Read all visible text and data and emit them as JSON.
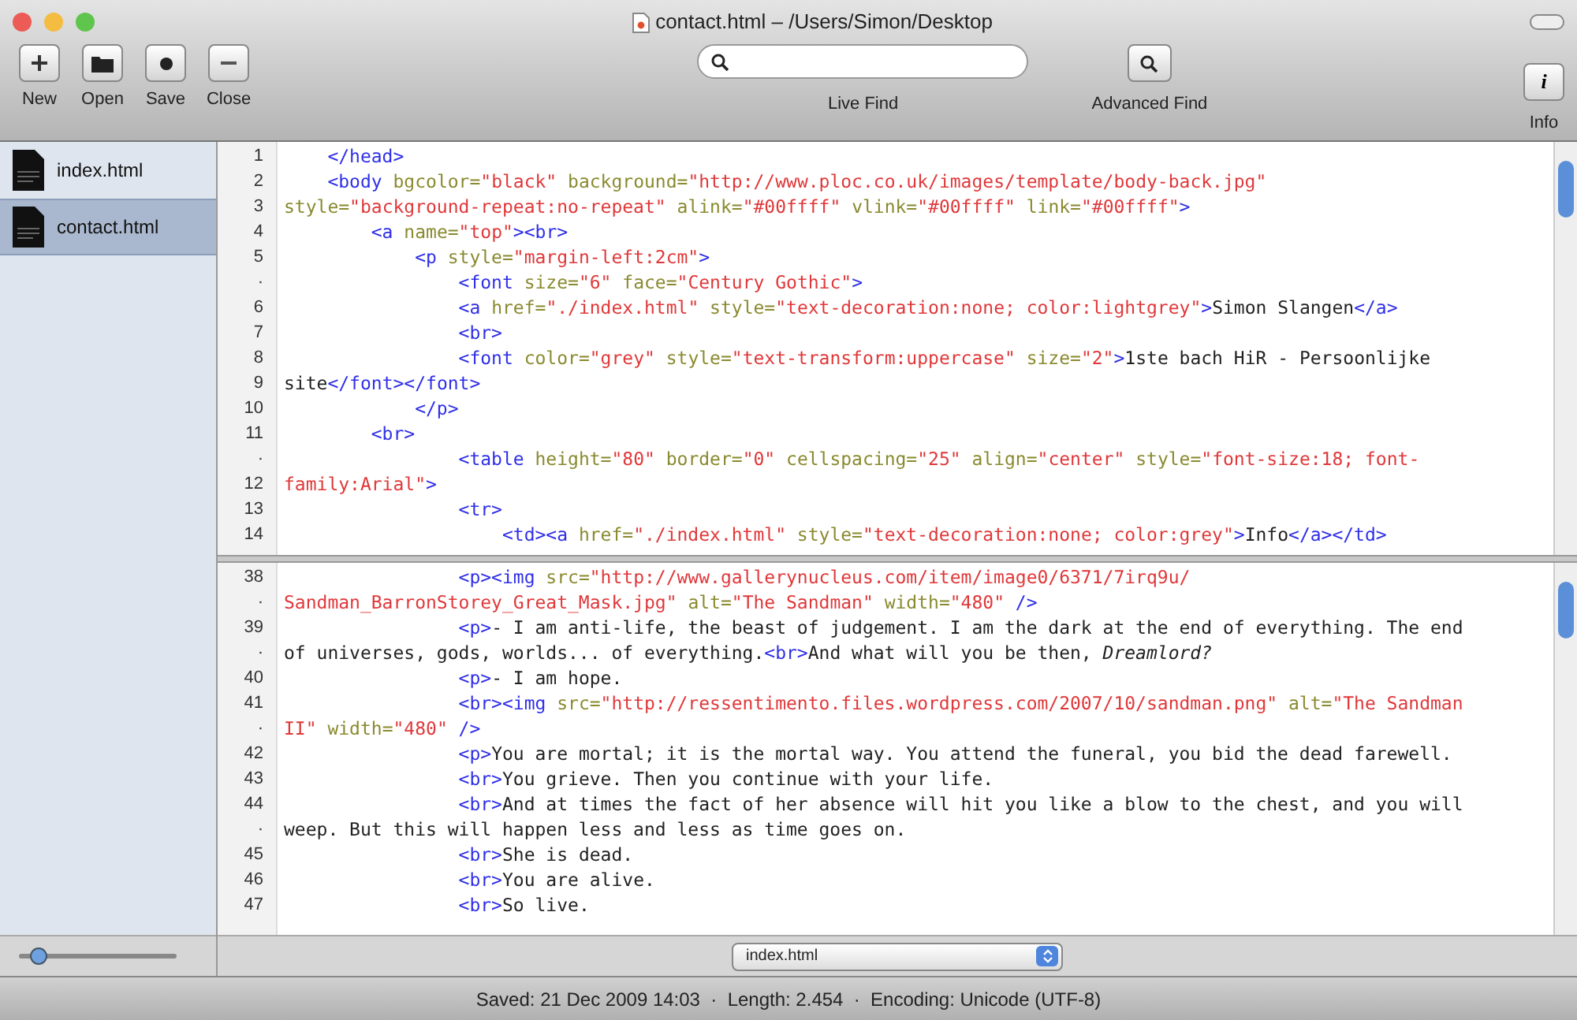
{
  "window": {
    "title": "contact.html – /Users/Simon/Desktop"
  },
  "toolbar": {
    "buttons": [
      {
        "kind": "plus",
        "label": "New"
      },
      {
        "kind": "folder",
        "label": "Open"
      },
      {
        "kind": "dot",
        "label": "Save"
      },
      {
        "kind": "minus",
        "label": "Close"
      }
    ],
    "live_find": {
      "label": "Live Find"
    },
    "advanced_find": {
      "label": "Advanced Find"
    },
    "info": {
      "glyph": "i",
      "label": "Info"
    }
  },
  "sidebar": {
    "files": [
      {
        "name": "index.html",
        "selected": false
      },
      {
        "name": "contact.html",
        "selected": true
      }
    ],
    "zoom_slider": {
      "level": 0.12
    }
  },
  "editor": {
    "panes": [
      {
        "rows": [
          {
            "number": "1",
            "tokens": [
              {
                "kind": "tag",
                "text": "    </head>"
              }
            ]
          },
          {
            "number": "2",
            "tokens": [
              {
                "kind": "tag",
                "text": "    <body "
              },
              {
                "kind": "attr",
                "text": "bgcolor="
              },
              {
                "kind": "value",
                "text": "\"black\" "
              },
              {
                "kind": "attr",
                "text": "background="
              },
              {
                "kind": "value",
                "text": "\"http://www.ploc.co.uk/images/template/body-back.jpg\""
              }
            ]
          },
          {
            "number": "3",
            "tokens": [
              {
                "kind": "attr",
                "text": "style="
              },
              {
                "kind": "value",
                "text": "\"background-repeat:no-repeat\" "
              },
              {
                "kind": "attr",
                "text": "alink="
              },
              {
                "kind": "value",
                "text": "\"#00ffff\" "
              },
              {
                "kind": "attr",
                "text": "vlink="
              },
              {
                "kind": "value",
                "text": "\"#00ffff\" "
              },
              {
                "kind": "attr",
                "text": "link="
              },
              {
                "kind": "value",
                "text": "\"#00ffff\""
              },
              {
                "kind": "tag",
                "text": ">"
              }
            ]
          },
          {
            "number": "4",
            "tokens": [
              {
                "kind": "tag",
                "text": "        <a "
              },
              {
                "kind": "attr",
                "text": "name="
              },
              {
                "kind": "value",
                "text": "\"top\""
              },
              {
                "kind": "tag",
                "text": "><br>"
              }
            ]
          },
          {
            "number": "5",
            "tokens": [
              {
                "kind": "tag",
                "text": "            <p "
              },
              {
                "kind": "attr",
                "text": "style="
              },
              {
                "kind": "value",
                "text": "\"margin-left:2cm\""
              },
              {
                "kind": "tag",
                "text": ">"
              }
            ]
          },
          {
            "number": "·",
            "tokens": [
              {
                "kind": "tag",
                "text": "                <font "
              },
              {
                "kind": "attr",
                "text": "size="
              },
              {
                "kind": "value",
                "text": "\"6\" "
              },
              {
                "kind": "attr",
                "text": "face="
              },
              {
                "kind": "value",
                "text": "\"Century Gothic\""
              },
              {
                "kind": "tag",
                "text": ">"
              }
            ]
          },
          {
            "number": "6",
            "tokens": [
              {
                "kind": "tag",
                "text": "                <a "
              },
              {
                "kind": "attr",
                "text": "href="
              },
              {
                "kind": "value",
                "text": "\"./index.html\" "
              },
              {
                "kind": "attr",
                "text": "style="
              },
              {
                "kind": "value",
                "text": "\"text-decoration:none; color:lightgrey\""
              },
              {
                "kind": "tag",
                "text": ">"
              },
              {
                "kind": "text",
                "text": "Simon Slangen"
              },
              {
                "kind": "tag",
                "text": "</a>"
              }
            ]
          },
          {
            "number": "7",
            "tokens": [
              {
                "kind": "tag",
                "text": "                <br>"
              }
            ]
          },
          {
            "number": "8",
            "tokens": [
              {
                "kind": "tag",
                "text": "                <font "
              },
              {
                "kind": "attr",
                "text": "color="
              },
              {
                "kind": "value",
                "text": "\"grey\" "
              },
              {
                "kind": "attr",
                "text": "style="
              },
              {
                "kind": "value",
                "text": "\"text-transform:uppercase\" "
              },
              {
                "kind": "attr",
                "text": "size="
              },
              {
                "kind": "value",
                "text": "\"2\""
              },
              {
                "kind": "tag",
                "text": ">"
              },
              {
                "kind": "text",
                "text": "1ste bach HiR - Persoonlijke"
              }
            ]
          },
          {
            "number": "9",
            "tokens": [
              {
                "kind": "text",
                "text": "site"
              },
              {
                "kind": "tag",
                "text": "</font></font>"
              }
            ]
          },
          {
            "number": "10",
            "tokens": [
              {
                "kind": "tag",
                "text": "            </p>"
              }
            ]
          },
          {
            "number": "11",
            "tokens": [
              {
                "kind": "tag",
                "text": "        <br>"
              }
            ]
          },
          {
            "number": "·",
            "tokens": [
              {
                "kind": "tag",
                "text": "                <table "
              },
              {
                "kind": "attr",
                "text": "height="
              },
              {
                "kind": "value",
                "text": "\"80\" "
              },
              {
                "kind": "attr",
                "text": "border="
              },
              {
                "kind": "value",
                "text": "\"0\" "
              },
              {
                "kind": "attr",
                "text": "cellspacing="
              },
              {
                "kind": "value",
                "text": "\"25\" "
              },
              {
                "kind": "attr",
                "text": "align="
              },
              {
                "kind": "value",
                "text": "\"center\" "
              },
              {
                "kind": "attr",
                "text": "style="
              },
              {
                "kind": "value",
                "text": "\"font-size:18; font-"
              }
            ]
          },
          {
            "number": "12",
            "tokens": [
              {
                "kind": "value",
                "text": "family:Arial\""
              },
              {
                "kind": "tag",
                "text": ">"
              }
            ]
          },
          {
            "number": "13",
            "tokens": [
              {
                "kind": "tag",
                "text": "                <tr>"
              }
            ]
          },
          {
            "number": "14",
            "tokens": [
              {
                "kind": "tag",
                "text": "                    <td><a "
              },
              {
                "kind": "attr",
                "text": "href="
              },
              {
                "kind": "value",
                "text": "\"./index.html\" "
              },
              {
                "kind": "attr",
                "text": "style="
              },
              {
                "kind": "value",
                "text": "\"text-decoration:none; color:grey\""
              },
              {
                "kind": "tag",
                "text": ">"
              },
              {
                "kind": "text",
                "text": "Info"
              },
              {
                "kind": "tag",
                "text": "</a></td>"
              }
            ]
          }
        ]
      },
      {
        "rows": [
          {
            "number": "38",
            "tokens": [
              {
                "kind": "tag",
                "text": "                <p><img "
              },
              {
                "kind": "attr",
                "text": "src="
              },
              {
                "kind": "value",
                "text": "\"http://www.gallerynucleus.com/item/image0/6371/7irq9u/"
              }
            ]
          },
          {
            "number": "·",
            "tokens": [
              {
                "kind": "value",
                "text": "Sandman_BarronStorey_Great_Mask.jpg\" "
              },
              {
                "kind": "attr",
                "text": "alt="
              },
              {
                "kind": "value",
                "text": "\"The Sandman\" "
              },
              {
                "kind": "attr",
                "text": "width="
              },
              {
                "kind": "value",
                "text": "\"480\" "
              },
              {
                "kind": "tag",
                "text": "/>"
              }
            ]
          },
          {
            "number": "39",
            "tokens": [
              {
                "kind": "tag",
                "text": "                <p>"
              },
              {
                "kind": "text",
                "text": "- I am anti-life, the beast of judgement. I am the dark at the end of everything. The end"
              }
            ]
          },
          {
            "number": "·",
            "tokens": [
              {
                "kind": "text",
                "text": "of universes, gods, worlds... of everything."
              },
              {
                "kind": "tag",
                "text": "<br>"
              },
              {
                "kind": "text",
                "text": "And what will you be then, "
              },
              {
                "kind": "italic",
                "text": "Dreamlord?"
              }
            ]
          },
          {
            "number": "40",
            "tokens": [
              {
                "kind": "tag",
                "text": "                <p>"
              },
              {
                "kind": "text",
                "text": "- I am hope."
              }
            ]
          },
          {
            "number": "41",
            "tokens": [
              {
                "kind": "tag",
                "text": "                <br><img "
              },
              {
                "kind": "attr",
                "text": "src="
              },
              {
                "kind": "value",
                "text": "\"http://ressentimento.files.wordpress.com/2007/10/sandman.png\" "
              },
              {
                "kind": "attr",
                "text": "alt="
              },
              {
                "kind": "value",
                "text": "\"The Sandman"
              }
            ]
          },
          {
            "number": "·",
            "tokens": [
              {
                "kind": "value",
                "text": "II\" "
              },
              {
                "kind": "attr",
                "text": "width="
              },
              {
                "kind": "value",
                "text": "\"480\" "
              },
              {
                "kind": "tag",
                "text": "/>"
              }
            ]
          },
          {
            "number": "42",
            "tokens": [
              {
                "kind": "tag",
                "text": "                <p>"
              },
              {
                "kind": "text",
                "text": "You are mortal; it is the mortal way. You attend the funeral, you bid the dead farewell."
              }
            ]
          },
          {
            "number": "43",
            "tokens": [
              {
                "kind": "tag",
                "text": "                <br>"
              },
              {
                "kind": "text",
                "text": "You grieve. Then you continue with your life."
              }
            ]
          },
          {
            "number": "44",
            "tokens": [
              {
                "kind": "tag",
                "text": "                <br>"
              },
              {
                "kind": "text",
                "text": "And at times the fact of her absence will hit you like a blow to the chest, and you will"
              }
            ]
          },
          {
            "number": "·",
            "tokens": [
              {
                "kind": "text",
                "text": "weep. But this will happen less and less as time goes on."
              }
            ]
          },
          {
            "number": "45",
            "tokens": [
              {
                "kind": "tag",
                "text": "                <br>"
              },
              {
                "kind": "text",
                "text": "She is dead."
              }
            ]
          },
          {
            "number": "46",
            "tokens": [
              {
                "kind": "tag",
                "text": "                <br>"
              },
              {
                "kind": "text",
                "text": "You are alive."
              }
            ]
          },
          {
            "number": "47",
            "tokens": [
              {
                "kind": "tag",
                "text": "                <br>"
              },
              {
                "kind": "text",
                "text": "So live."
              }
            ]
          }
        ]
      }
    ],
    "document_popup": {
      "value": "index.html"
    }
  },
  "status_bar": {
    "text": "Saved: 21 Dec 2009 14:03  ·  Length: 2.454  ·  Encoding: Unicode (UTF-8)"
  }
}
